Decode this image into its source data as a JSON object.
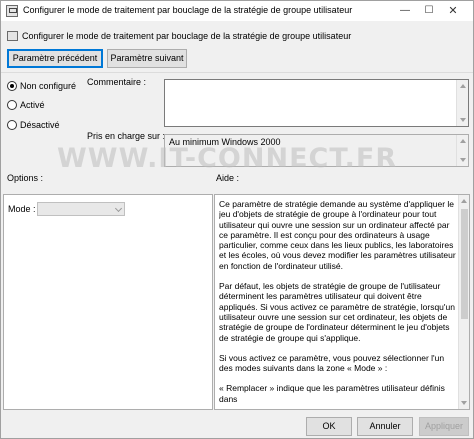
{
  "window": {
    "title": "Configurer le mode de traitement par bouclage de la stratégie de groupe utilisateur",
    "minimize_glyph": "—",
    "maximize_glyph": "☐",
    "close_glyph": "✕"
  },
  "header": {
    "setting_name": "Configurer le mode de traitement par bouclage de la stratégie de groupe utilisateur"
  },
  "nav": {
    "prev_label": "Paramètre précédent",
    "next_label": "Paramètre suivant"
  },
  "state": {
    "options": [
      {
        "label": "Non configuré",
        "checked": true
      },
      {
        "label": "Activé",
        "checked": false
      },
      {
        "label": "Désactivé",
        "checked": false
      }
    ]
  },
  "comment": {
    "label": "Commentaire :",
    "value": ""
  },
  "supported": {
    "label": "Pris en charge sur :",
    "value": "Au minimum Windows 2000"
  },
  "watermark": "WWW.IT-CONNECT.FR",
  "options_section": {
    "label": "Options :",
    "mode_label": "Mode :",
    "mode_value": ""
  },
  "help_section": {
    "label": "Aide :",
    "paragraphs": [
      "Ce paramètre de stratégie demande au système d'appliquer le jeu d'objets de stratégie de groupe à l'ordinateur pour tout utilisateur qui ouvre une session sur un ordinateur affecté par ce paramètre. Il est conçu pour des ordinateurs à usage particulier, comme ceux dans les lieux publics, les laboratoires et les écoles, où vous devez modifier les paramètres utilisateur en fonction de l'ordinateur utilisé.",
      "Par défaut, les objets de stratégie de groupe de l'utilisateur déterminent les paramètres utilisateur qui doivent être appliqués. Si vous activez ce paramètre de stratégie, lorsqu'un utilisateur ouvre une session sur cet ordinateur, les objets de stratégie de groupe de l'ordinateur déterminent le jeu d'objets de stratégie de groupe qui s'applique.",
      "Si vous activez ce paramètre, vous pouvez sélectionner l'un des modes suivants dans la zone « Mode » :",
      "« Remplacer » indique que les paramètres utilisateur définis dans"
    ]
  },
  "footer": {
    "ok_label": "OK",
    "cancel_label": "Annuler",
    "apply_label": "Appliquer"
  }
}
